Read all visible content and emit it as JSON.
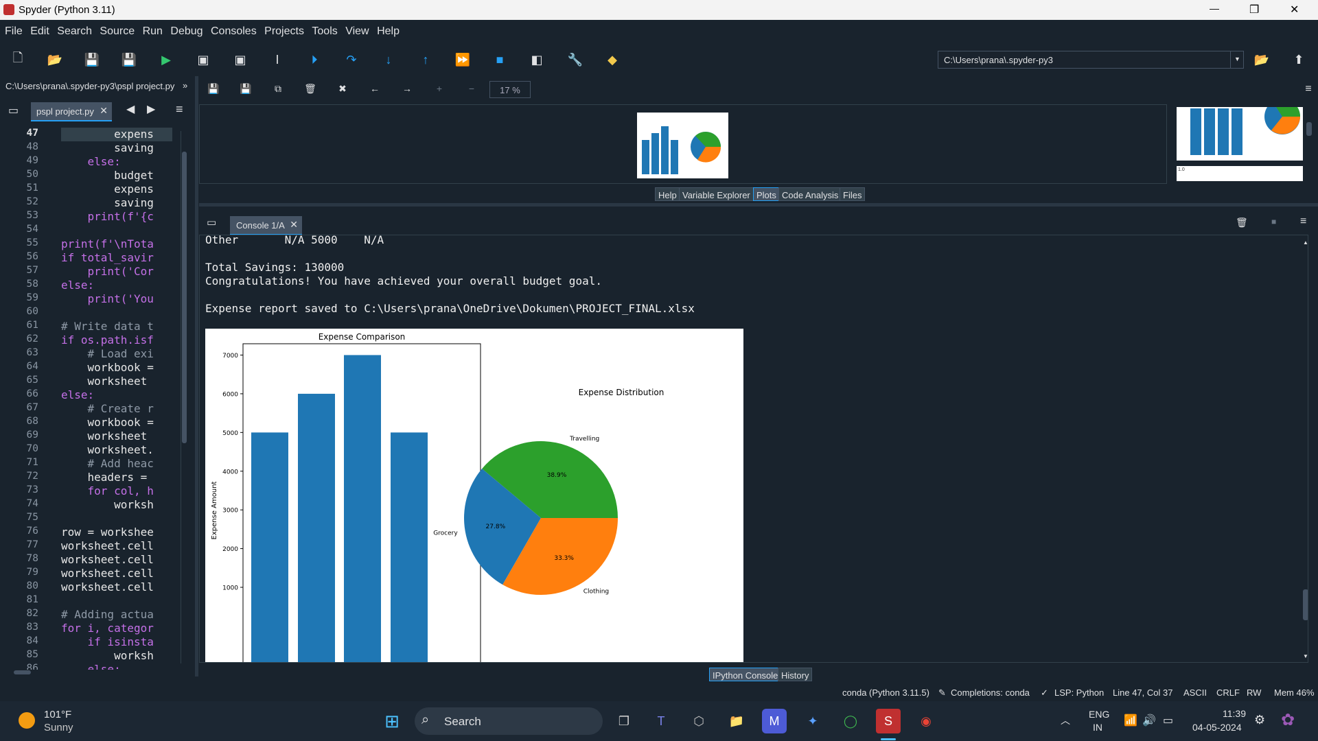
{
  "window": {
    "title": "Spyder (Python 3.11)",
    "minimize": "—",
    "maximize": "❐",
    "close": "✕"
  },
  "menu": [
    "File",
    "Edit",
    "Search",
    "Source",
    "Run",
    "Debug",
    "Consoles",
    "Projects",
    "Tools",
    "View",
    "Help"
  ],
  "toolbar": {
    "path": "C:\\Users\\prana\\.spyder-py3"
  },
  "editor": {
    "path": "C:\\Users\\prana\\.spyder-py3\\pspl project.py",
    "more": "»",
    "tab": "pspl project.py",
    "lines": [
      {
        "n": "47",
        "code": "        expens"
      },
      {
        "n": "48",
        "code": "        saving"
      },
      {
        "n": "49",
        "code": "    else:"
      },
      {
        "n": "50",
        "code": "        budget"
      },
      {
        "n": "51",
        "code": "        expens"
      },
      {
        "n": "52",
        "code": "        saving"
      },
      {
        "n": "53",
        "code": "    print(f'{c"
      },
      {
        "n": "54",
        "code": ""
      },
      {
        "n": "55",
        "code": "print(f'\\nTota"
      },
      {
        "n": "56",
        "code": "if total_savir"
      },
      {
        "n": "57",
        "code": "    print('Cor"
      },
      {
        "n": "58",
        "code": "else:"
      },
      {
        "n": "59",
        "code": "    print('You"
      },
      {
        "n": "60",
        "code": ""
      },
      {
        "n": "61",
        "code": "# Write data t"
      },
      {
        "n": "62",
        "code": "if os.path.isf"
      },
      {
        "n": "63",
        "code": "    # Load exi"
      },
      {
        "n": "64",
        "code": "    workbook ="
      },
      {
        "n": "65",
        "code": "    worksheet"
      },
      {
        "n": "66",
        "code": "else:"
      },
      {
        "n": "67",
        "code": "    # Create r"
      },
      {
        "n": "68",
        "code": "    workbook ="
      },
      {
        "n": "69",
        "code": "    worksheet"
      },
      {
        "n": "70",
        "code": "    worksheet."
      },
      {
        "n": "71",
        "code": "    # Add heac"
      },
      {
        "n": "72",
        "code": "    headers ="
      },
      {
        "n": "73",
        "code": "    for col, h"
      },
      {
        "n": "74",
        "code": "        worksh"
      },
      {
        "n": "75",
        "code": ""
      },
      {
        "n": "76",
        "code": "row = workshee"
      },
      {
        "n": "77",
        "code": "worksheet.cell"
      },
      {
        "n": "78",
        "code": "worksheet.cell"
      },
      {
        "n": "79",
        "code": "worksheet.cell"
      },
      {
        "n": "80",
        "code": "worksheet.cell"
      },
      {
        "n": "81",
        "code": ""
      },
      {
        "n": "82",
        "code": "# Adding actua"
      },
      {
        "n": "83",
        "code": "for i, categor"
      },
      {
        "n": "84",
        "code": "    if isinsta"
      },
      {
        "n": "85",
        "code": "        worksh"
      },
      {
        "n": "86",
        "code": "    else:"
      }
    ]
  },
  "plots": {
    "zoom": "17 %",
    "tabs": [
      "Help",
      "Variable Explorer",
      "Plots",
      "Code Analysis",
      "Files"
    ],
    "thumb_label": "1.0"
  },
  "console": {
    "tab": "Console 1/A",
    "lines": [
      "Other       N/A 5000    N/A",
      "",
      "Total Savings: 130000",
      "Congratulations! You have achieved your overall budget goal.",
      "",
      "Expense report saved to C:\\Users\\prana\\OneDrive\\Dokumen\\PROJECT_FINAL.xlsx"
    ]
  },
  "chart_data": [
    {
      "type": "bar",
      "title": "Expense Comparison",
      "ylabel": "Expense Amount",
      "xlabel": "",
      "categories": [
        "",
        "",
        "",
        ""
      ],
      "values": [
        5000,
        6000,
        7000,
        5000
      ],
      "yticks": [
        "1000",
        "2000",
        "3000",
        "4000",
        "5000",
        "6000",
        "7000"
      ],
      "ylim": [
        0,
        7350
      ],
      "color": "#1f77b4"
    },
    {
      "type": "pie",
      "title": "Expense Distribution",
      "slices": [
        {
          "label": "Travelling",
          "value": 38.9,
          "pct": "38.9%",
          "color": "#2ca02c"
        },
        {
          "label": "Grocery",
          "value": 27.8,
          "pct": "27.8%",
          "color": "#1f77b4"
        },
        {
          "label": "Clothing",
          "value": 33.3,
          "pct": "33.3%",
          "color": "#ff7f0e"
        }
      ]
    }
  ],
  "bottom_tabs": [
    "IPython Console",
    "History"
  ],
  "status": {
    "env": "conda (Python 3.11.5)",
    "completions": "Completions: conda",
    "lsp": "LSP: Python",
    "pos": "Line 47, Col 37",
    "enc": "ASCII",
    "eol": "CRLF",
    "rw": "RW",
    "mem": "Mem 46%"
  },
  "taskbar": {
    "temp": "101°F",
    "weather": "Sunny",
    "search": "Search",
    "lang1": "ENG",
    "lang2": "IN",
    "time": "11:39",
    "date": "04-05-2024"
  }
}
